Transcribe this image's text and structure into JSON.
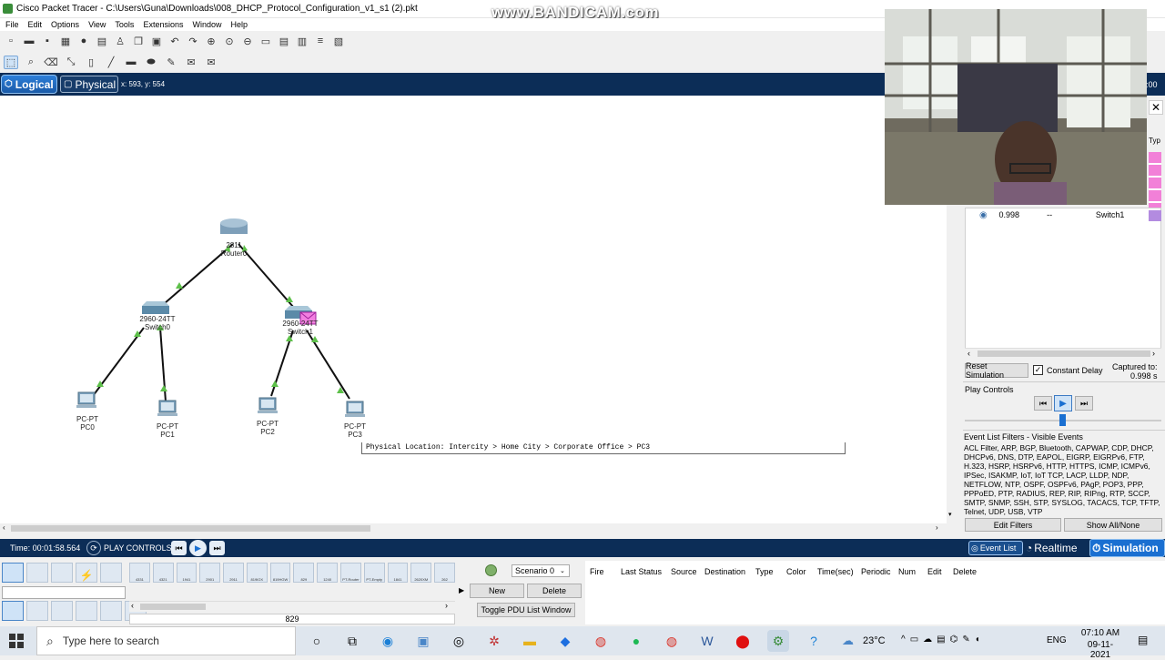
{
  "window": {
    "title": "Cisco Packet Tracer - C:\\Users\\Guna\\Downloads\\008_DHCP_Protocol_Configuration_v1_s1 (2).pkt",
    "watermark": "www.BANDICAM.com"
  },
  "menu": [
    "File",
    "Edit",
    "Options",
    "View",
    "Tools",
    "Extensions",
    "Window",
    "Help"
  ],
  "mode_tabs": {
    "logical": "Logical",
    "physical": "Physical",
    "coords": "x: 593, y: 554",
    "time_suffix": ":00"
  },
  "devices": {
    "router": {
      "model": "2811",
      "name": "Router0"
    },
    "switch0": {
      "model": "2960-24TT",
      "name": "Switch0"
    },
    "switch1": {
      "model": "2960-24TT",
      "name": "Switch1"
    },
    "pc0": {
      "model": "PC-PT",
      "name": "PC0"
    },
    "pc1": {
      "model": "PC-PT",
      "name": "PC1"
    },
    "pc2": {
      "model": "PC-PT",
      "name": "PC2"
    },
    "pc3": {
      "model": "PC-PT",
      "name": "PC3"
    }
  },
  "tooltip": "Physical Location: Intercity > Home City > Corporate Office > PC3",
  "simulation_panel": {
    "col_type": "Typ",
    "event_row": {
      "time": "0.998",
      "last": "--",
      "at_device": "Switch1"
    },
    "reset_simulation": "Reset Simulation",
    "constant_delay": "Constant Delay",
    "captured_to_label": "Captured to:",
    "captured_to_value": "0.998 s",
    "play_controls": "Play Controls",
    "event_filters_title": "Event List Filters - Visible Events",
    "event_filters_list": "ACL Filter, ARP, BGP, Bluetooth, CAPWAP, CDP, DHCP, DHCPv6, DNS, DTP, EAPOL, EIGRP, EIGRPv6, FTP, H.323, HSRP, HSRPv6, HTTP, HTTPS, ICMP, ICMPv6, IPSec, ISAKMP, IoT, IoT TCP, LACP, LLDP, NDP, NETFLOW, NTP, OSPF, OSPFv6, PAgP, POP3, PPP, PPPoED, PTP, RADIUS, REP, RIP, RIPng, RTP, SCCP, SMTP, SNMP, SSH, STP, SYSLOG, TACACS, TCP, TFTP, Telnet, UDP, USB, VTP",
    "edit_filters": "Edit Filters",
    "show_all": "Show All/None"
  },
  "bottom_bar": {
    "time": "Time: 00:01:58.564",
    "play_controls": "PLAY CONTROLS",
    "event_list": "Event List",
    "realtime": "Realtime",
    "simulation": "Simulation"
  },
  "device_palette": {
    "models": [
      "4331",
      "4321",
      "1941",
      "2901",
      "2911",
      "819IOX",
      "819HGW",
      "829",
      "1240",
      "PT-Router",
      "PT-Empty",
      "1841",
      "2620XM",
      "262"
    ],
    "count_label": "829"
  },
  "scenario": {
    "selected": "Scenario 0",
    "new_button": "New",
    "delete_button": "Delete",
    "toggle_pdu": "Toggle PDU List Window"
  },
  "pdu_table": {
    "headers": [
      "Fire",
      "Last Status",
      "Source",
      "Destination",
      "Type",
      "Color",
      "Time(sec)",
      "Periodic",
      "Num",
      "Edit",
      "Delete"
    ]
  },
  "taskbar": {
    "search_placeholder": "Type here to search",
    "temperature": "23°C",
    "language": "ENG",
    "time": "07:10 AM",
    "date": "09-11-2021"
  },
  "colors": {
    "navy": "#0c2d57",
    "accent": "#1a6fd1",
    "pink": "#f280d8",
    "purple": "#b38be0",
    "link_dot": "#5ec04a"
  }
}
